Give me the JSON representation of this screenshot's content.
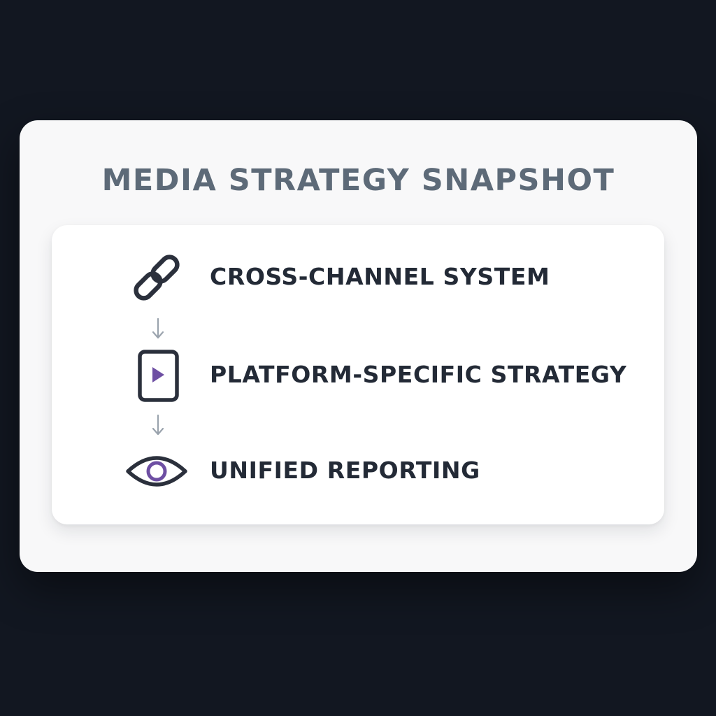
{
  "card": {
    "title": "MEDIA STRATEGY SNAPSHOT"
  },
  "steps": [
    {
      "icon": "link-icon",
      "label": "CROSS-CHANNEL SYSTEM"
    },
    {
      "icon": "tablet-play-icon",
      "label": "PLATFORM-SPECIFIC STRATEGY"
    },
    {
      "icon": "eye-icon",
      "label": "UNIFIED REPORTING"
    }
  ],
  "colors": {
    "background": "#121721",
    "card": "#f8f8f9",
    "title": "#5d6a78",
    "label": "#232a36",
    "icon_stroke": "#2b303c",
    "accent_purple": "#6e4fa3",
    "arrow": "#9aa3ad"
  }
}
